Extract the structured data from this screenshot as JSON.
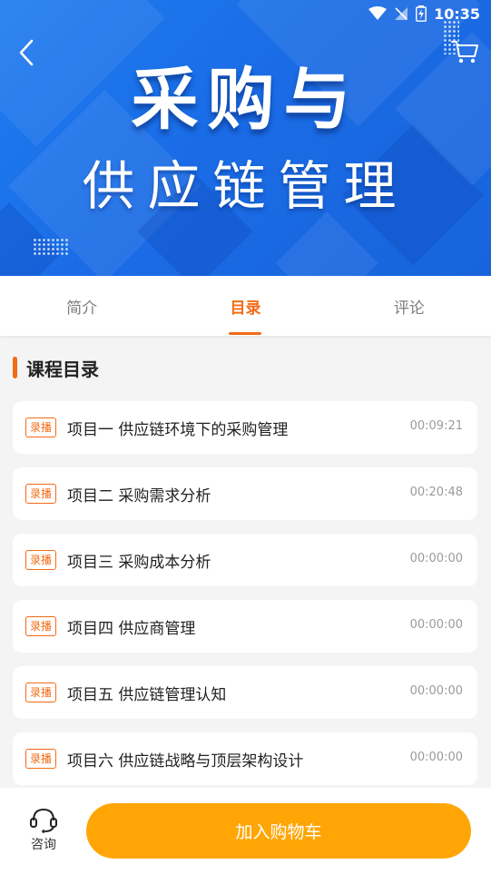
{
  "status": {
    "time": "10:35"
  },
  "banner": {
    "title_line1": "采购与",
    "title_line2": "供应链管理"
  },
  "tabs": [
    {
      "label": "简介",
      "active": false
    },
    {
      "label": "目录",
      "active": true
    },
    {
      "label": "评论",
      "active": false
    }
  ],
  "section": {
    "title": "课程目录"
  },
  "items": [
    {
      "tag": "录播",
      "name": "项目一 供应链环境下的采购管理",
      "duration": "00:09:21"
    },
    {
      "tag": "录播",
      "name": "项目二 采购需求分析",
      "duration": "00:20:48"
    },
    {
      "tag": "录播",
      "name": "项目三 采购成本分析",
      "duration": "00:00:00"
    },
    {
      "tag": "录播",
      "name": "项目四 供应商管理",
      "duration": "00:00:00"
    },
    {
      "tag": "录播",
      "name": "项目五 供应链管理认知",
      "duration": "00:00:00"
    },
    {
      "tag": "录播",
      "name": "项目六 供应链战略与顶层架构设计",
      "duration": "00:00:00"
    }
  ],
  "bottom": {
    "consult_label": "咨询",
    "add_cart_label": "加入购物车"
  },
  "colors": {
    "accent": "#f26b16",
    "cta": "#ffa606",
    "banner": "#1a6ce6"
  },
  "icons": [
    "back-arrow-icon",
    "cart-icon",
    "headset-icon",
    "wifi-icon",
    "signal-icon",
    "battery-icon"
  ]
}
